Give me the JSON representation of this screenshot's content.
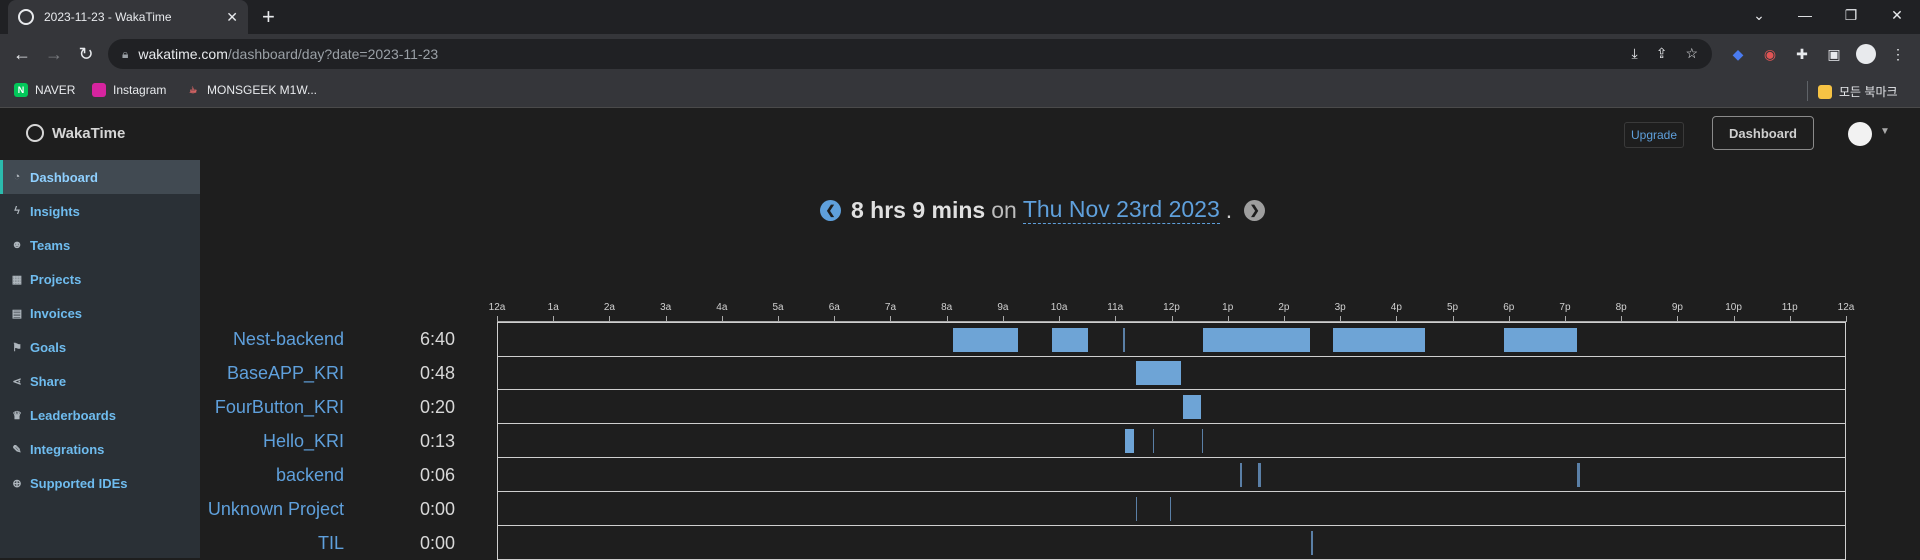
{
  "browser": {
    "tab_title": "2023-11-23 - WakaTime",
    "url_host": "wakatime.com",
    "url_path": "/dashboard/day?date=2023-11-23",
    "bookmarks": [
      "NAVER",
      "Instagram",
      "MONSGEEK M1W...",
      "모든 북마크"
    ]
  },
  "app": {
    "brand": "WakaTime",
    "upgrade_label": "Upgrade",
    "dashboard_label": "Dashboard",
    "sidebar": [
      {
        "label": "Dashboard",
        "icon": "dashboard-icon",
        "active": true
      },
      {
        "label": "Insights",
        "icon": "bolt-icon"
      },
      {
        "label": "Teams",
        "icon": "users-icon"
      },
      {
        "label": "Projects",
        "icon": "grid-icon"
      },
      {
        "label": "Invoices",
        "icon": "file-icon"
      },
      {
        "label": "Goals",
        "icon": "flag-icon"
      },
      {
        "label": "Share",
        "icon": "share-icon"
      },
      {
        "label": "Leaderboards",
        "icon": "trophy-icon"
      },
      {
        "label": "Integrations",
        "icon": "wrench-icon"
      },
      {
        "label": "Supported IDEs",
        "icon": "plus-circle-icon"
      }
    ],
    "headline": {
      "total": "8 hrs 9 mins",
      "on": "on",
      "date": "Thu Nov 23rd 2023",
      "dot": "."
    },
    "colors": {
      "accent": "#5fa0dc",
      "bar": "#6ea4d6",
      "active_border": "#2bbbad"
    }
  },
  "timeline": {
    "ticks": [
      "12a",
      "1a",
      "2a",
      "3a",
      "4a",
      "5a",
      "6a",
      "7a",
      "8a",
      "9a",
      "10a",
      "11a",
      "12p",
      "1p",
      "2p",
      "3p",
      "4p",
      "5p",
      "6p",
      "7p",
      "8p",
      "9p",
      "10p",
      "11p",
      "12a"
    ],
    "projects": [
      {
        "name": "Nest-backend",
        "time": "6:40",
        "segments": [
          [
            8.1,
            9.25
          ],
          [
            9.85,
            10.5
          ],
          [
            11.12,
            11.16
          ],
          [
            12.55,
            13.25
          ],
          [
            13.25,
            13.55
          ],
          [
            13.55,
            14.45
          ],
          [
            14.85,
            14.95
          ],
          [
            14.95,
            16.5
          ],
          [
            17.9,
            19.2
          ]
        ]
      },
      {
        "name": "BaseAPP_KRI",
        "time": "0:48",
        "segments": [
          [
            11.35,
            11.65
          ],
          [
            11.65,
            11.9
          ],
          [
            11.9,
            12.15
          ]
        ]
      },
      {
        "name": "FourButton_KRI",
        "time": "0:20",
        "segments": [
          [
            12.18,
            12.5
          ]
        ]
      },
      {
        "name": "Hello_KRI",
        "time": "0:13",
        "segments": [
          [
            11.15,
            11.32
          ],
          [
            11.65,
            11.68
          ],
          [
            12.52,
            12.55
          ]
        ]
      },
      {
        "name": "backend",
        "time": "0:06",
        "segments": [
          [
            13.2,
            13.23
          ],
          [
            13.52,
            13.58
          ],
          [
            19.2,
            19.25
          ]
        ]
      },
      {
        "name": "Unknown Project",
        "time": "0:00",
        "segments": [
          [
            11.35,
            11.37
          ],
          [
            11.95,
            11.97
          ]
        ]
      },
      {
        "name": "TIL",
        "time": "0:00",
        "segments": [
          [
            14.47,
            14.49
          ]
        ]
      }
    ]
  }
}
